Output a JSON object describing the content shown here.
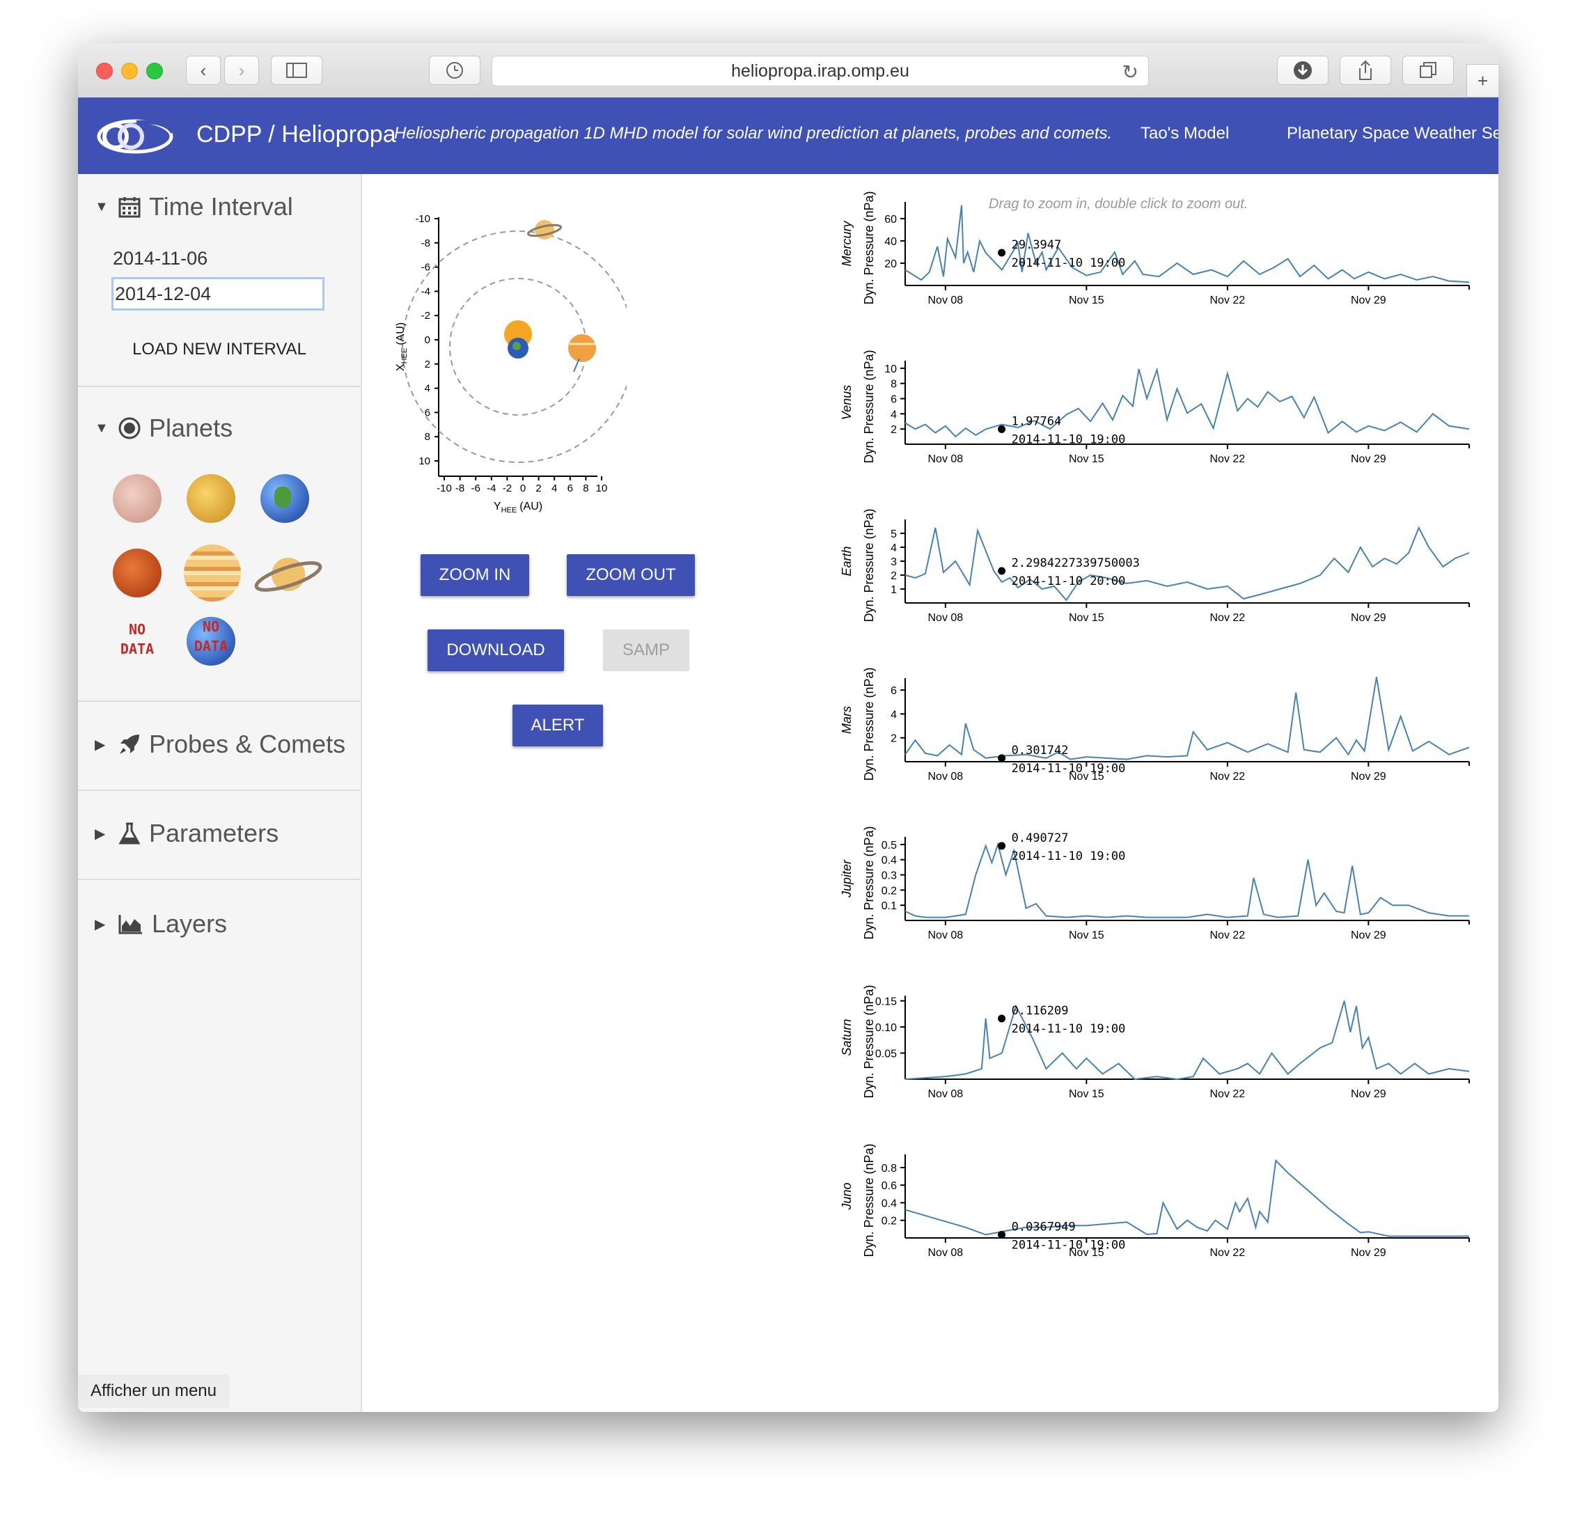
{
  "browser": {
    "url": "heliopropa.irap.omp.eu"
  },
  "header": {
    "brand": "CDPP / Heliopropa",
    "tagline": "Heliospheric propagation 1D MHD model for solar wind prediction at planets, probes and comets.",
    "nav": [
      "Tao's Model",
      "Planetary Space Weather Se"
    ]
  },
  "sidebar": {
    "time_interval": {
      "title": "Time Interval",
      "start": "2014-11-06",
      "end": "2014-12-04",
      "load_button": "LOAD NEW INTERVAL"
    },
    "planets": {
      "title": "Planets",
      "nodata_label_1": "NO",
      "nodata_label_2": "DATA",
      "items": [
        "mercury",
        "venus",
        "earth",
        "mars",
        "jupiter",
        "saturn",
        "rosetta",
        "juno"
      ]
    },
    "probes": {
      "title": "Probes & Comets"
    },
    "parameters": {
      "title": "Parameters"
    },
    "layers": {
      "title": "Layers"
    },
    "footer_hint": "Afficher un menu"
  },
  "orbit_plot": {
    "x_axis_label": "Y",
    "x_axis_sub": "HEE",
    "x_axis_unit": "(AU)",
    "y_axis_label": "X",
    "y_axis_sub": "HEE",
    "y_axis_unit": "(AU)",
    "ticks": [
      "-10",
      "-8",
      "-6",
      "-4",
      "-2",
      "0",
      "2",
      "4",
      "6",
      "8",
      "10"
    ]
  },
  "controls": {
    "zoom_in": "ZOOM IN",
    "zoom_out": "ZOOM OUT",
    "download": "DOWNLOAD",
    "samp": "SAMP",
    "alert": "ALERT"
  },
  "hint": "Drag to zoom in, double click to zoom out.",
  "chart_data": [
    {
      "type": "line",
      "title": "",
      "planet": "Mercury",
      "ylabel": "Dyn. Pressure (nPa)",
      "ylim": [
        0,
        75
      ],
      "yticks": [
        "20",
        "40",
        "60"
      ],
      "ytick_values": [
        20,
        40,
        60
      ],
      "xticks": [
        "Nov 08",
        "Nov 15",
        "Nov 22",
        "Nov 29"
      ],
      "xtick_days": [
        8,
        15,
        22,
        29
      ],
      "xlim_days": [
        6,
        34
      ],
      "x_days": [
        6.0,
        6.8,
        7.2,
        7.6,
        7.9,
        8.1,
        8.5,
        8.8,
        8.9,
        9.1,
        9.4,
        9.7,
        10.0,
        10.8,
        11.6,
        11.8,
        12.1,
        12.5,
        12.8,
        13.0,
        13.6,
        14.3,
        15.0,
        15.7,
        16.4,
        16.8,
        17.4,
        17.8,
        18.6,
        19.5,
        20.3,
        21.2,
        22.0,
        22.8,
        23.6,
        24.3,
        25.0,
        25.6,
        26.3,
        27.0,
        27.7,
        28.3,
        29.0,
        29.8,
        30.6,
        31.4,
        32.2,
        33.0,
        34.0
      ],
      "values": [
        14,
        5,
        12,
        35,
        8,
        42,
        25,
        72,
        20,
        30,
        12,
        40,
        29.3947,
        14,
        38,
        12,
        47,
        20,
        30,
        14,
        34,
        16,
        9,
        12,
        30,
        10,
        22,
        10,
        8,
        20,
        10,
        14,
        8,
        22,
        10,
        16,
        24,
        8,
        18,
        6,
        14,
        6,
        12,
        6,
        10,
        5,
        8,
        4,
        3
      ],
      "cursor": {
        "value": "29.3947",
        "time": "2014-11-10 19:00"
      }
    },
    {
      "type": "line",
      "title": "",
      "planet": "Venus",
      "ylabel": "Dyn. Pressure (nPa)",
      "ylim": [
        0,
        11
      ],
      "yticks": [
        "2",
        "4",
        "6",
        "8",
        "10"
      ],
      "ytick_values": [
        2,
        4,
        6,
        8,
        10
      ],
      "xticks": [
        "Nov 08",
        "Nov 15",
        "Nov 22",
        "Nov 29"
      ],
      "xtick_days": [
        8,
        15,
        22,
        29
      ],
      "xlim_days": [
        6,
        34
      ],
      "x_days": [
        6.0,
        6.5,
        7.0,
        7.5,
        8.0,
        8.5,
        9.0,
        9.5,
        10.0,
        10.8,
        11.6,
        12.4,
        13.2,
        14.0,
        14.6,
        15.2,
        15.8,
        16.3,
        16.8,
        17.3,
        17.6,
        18.0,
        18.5,
        19.0,
        19.5,
        20.0,
        20.7,
        21.3,
        22.0,
        22.5,
        23.0,
        23.5,
        24.0,
        24.6,
        25.2,
        25.8,
        26.3,
        27.0,
        27.7,
        28.4,
        29.0,
        29.8,
        30.6,
        31.4,
        32.2,
        33.0,
        34.0
      ],
      "values": [
        2.8,
        2.0,
        2.6,
        1.5,
        2.4,
        1.0,
        2.1,
        1.2,
        1.97764,
        2.6,
        2.2,
        3.1,
        2.0,
        3.9,
        4.7,
        3.0,
        5.4,
        3.2,
        6.4,
        5.0,
        9.9,
        6.0,
        9.8,
        3.2,
        7.3,
        4.1,
        5.3,
        2.1,
        9.3,
        4.4,
        6.0,
        4.9,
        6.9,
        5.6,
        6.3,
        3.5,
        6.2,
        1.5,
        3.0,
        1.6,
        2.4,
        1.8,
        2.9,
        1.6,
        4.0,
        2.4,
        2.0
      ],
      "cursor": {
        "value": "1.97764",
        "time": "2014-11-10 19:00"
      }
    },
    {
      "type": "line",
      "title": "",
      "planet": "Earth",
      "ylabel": "Dyn. Pressure (nPa)",
      "ylim": [
        0,
        6
      ],
      "yticks": [
        "1",
        "2",
        "3",
        "4",
        "5"
      ],
      "ytick_values": [
        1,
        2,
        3,
        4,
        5
      ],
      "xticks": [
        "Nov 08",
        "Nov 15",
        "Nov 22",
        "Nov 29"
      ],
      "xtick_days": [
        8,
        15,
        22,
        29
      ],
      "xlim_days": [
        6,
        34
      ],
      "x_days": [
        6.0,
        6.5,
        7.0,
        7.5,
        7.9,
        8.5,
        9.2,
        9.6,
        10.4,
        10.8,
        11.2,
        11.6,
        12.2,
        12.8,
        13.4,
        14.0,
        14.6,
        15.2,
        16.0,
        17.0,
        18.0,
        19.0,
        20.0,
        21.0,
        22.0,
        22.8,
        23.6,
        24.6,
        25.6,
        26.6,
        27.3,
        28.0,
        28.6,
        29.2,
        29.8,
        30.4,
        31.0,
        31.5,
        32.0,
        32.7,
        33.3,
        34.0
      ],
      "values": [
        2.0,
        1.8,
        2.1,
        5.4,
        2.2,
        3.0,
        1.3,
        5.2,
        2.2984227339750003,
        1.5,
        1.8,
        1.1,
        1.7,
        1.0,
        1.2,
        0.2,
        1.5,
        2.0,
        1.8,
        1.4,
        1.6,
        1.2,
        1.5,
        1.0,
        1.2,
        0.3,
        0.6,
        1.0,
        1.4,
        2.0,
        3.2,
        2.2,
        4.0,
        2.6,
        3.2,
        2.8,
        3.6,
        5.4,
        4.0,
        2.6,
        3.2,
        3.6
      ],
      "cursor": {
        "value": "2.2984227339750003",
        "time": "2014-11-10 20:00"
      }
    },
    {
      "type": "line",
      "title": "",
      "planet": "Mars",
      "ylabel": "Dyn. Pressure (nPa)",
      "ylim": [
        0,
        7
      ],
      "yticks": [
        "2",
        "4",
        "6"
      ],
      "ytick_values": [
        2,
        4,
        6
      ],
      "xticks": [
        "Nov 08",
        "Nov 15",
        "Nov 22",
        "Nov 29"
      ],
      "xtick_days": [
        8,
        15,
        22,
        29
      ],
      "xlim_days": [
        6,
        34
      ],
      "x_days": [
        6.0,
        6.5,
        7.0,
        7.6,
        8.2,
        8.8,
        9.0,
        9.4,
        10.0,
        11.0,
        12.0,
        13.0,
        13.6,
        14.2,
        15.0,
        16.0,
        17.0,
        18.0,
        19.0,
        20.0,
        20.3,
        21.0,
        22.0,
        23.0,
        24.0,
        25.0,
        25.4,
        25.8,
        26.6,
        27.4,
        28.0,
        28.4,
        28.8,
        29.4,
        30.0,
        30.6,
        31.2,
        32.0,
        33.0,
        34.0
      ],
      "values": [
        0.6,
        1.8,
        0.7,
        0.5,
        1.4,
        0.6,
        3.2,
        1.0,
        0.301742,
        0.5,
        0.6,
        0.3,
        0.8,
        0.2,
        0.4,
        0.3,
        0.2,
        0.5,
        0.4,
        0.5,
        2.5,
        1.0,
        1.6,
        0.8,
        1.5,
        0.8,
        5.8,
        1.0,
        0.8,
        2.0,
        0.6,
        1.8,
        0.9,
        7.1,
        1.0,
        3.8,
        0.9,
        1.7,
        0.6,
        1.2
      ],
      "cursor": {
        "value": "0.301742",
        "time": "2014-11-10 19:00"
      }
    },
    {
      "type": "line",
      "title": "",
      "planet": "Jupiter",
      "ylabel": "Dyn. Pressure (nPa)",
      "ylim": [
        0,
        0.55
      ],
      "yticks": [
        "0.1",
        "0.2",
        "0.3",
        "0.4",
        "0.5"
      ],
      "ytick_values": [
        0.1,
        0.2,
        0.3,
        0.4,
        0.5
      ],
      "xticks": [
        "Nov 08",
        "Nov 15",
        "Nov 22",
        "Nov 29"
      ],
      "xtick_days": [
        8,
        15,
        22,
        29
      ],
      "xlim_days": [
        6,
        34
      ],
      "x_days": [
        6.0,
        6.5,
        7.0,
        8.0,
        9.0,
        9.5,
        10.0,
        10.3,
        10.6,
        11.0,
        11.4,
        12.0,
        12.5,
        13.0,
        14.0,
        15.0,
        16.0,
        17.0,
        18.0,
        19.0,
        20.0,
        21.0,
        22.0,
        23.0,
        23.3,
        23.8,
        24.5,
        25.5,
        26.0,
        26.4,
        26.8,
        27.4,
        27.8,
        28.2,
        28.6,
        29.0,
        29.6,
        30.2,
        31.0,
        32.0,
        33.0,
        34.0
      ],
      "values": [
        0.06,
        0.03,
        0.02,
        0.02,
        0.04,
        0.3,
        0.490727,
        0.38,
        0.5,
        0.3,
        0.46,
        0.08,
        0.11,
        0.03,
        0.02,
        0.03,
        0.02,
        0.03,
        0.02,
        0.02,
        0.02,
        0.04,
        0.02,
        0.03,
        0.28,
        0.04,
        0.02,
        0.03,
        0.4,
        0.1,
        0.18,
        0.06,
        0.05,
        0.36,
        0.04,
        0.05,
        0.15,
        0.1,
        0.1,
        0.05,
        0.03,
        0.03
      ],
      "cursor": {
        "value": "0.490727",
        "time": "2014-11-10 19:00"
      }
    },
    {
      "type": "line",
      "title": "",
      "planet": "Saturn",
      "ylabel": "Dyn. Pressure (nPa)",
      "ylim": [
        0,
        0.16
      ],
      "yticks": [
        "0.05",
        "0.10",
        "0.15"
      ],
      "ytick_values": [
        0.05,
        0.1,
        0.15
      ],
      "xticks": [
        "Nov 08",
        "Nov 15",
        "Nov 22",
        "Nov 29"
      ],
      "xtick_days": [
        8,
        15,
        22,
        29
      ],
      "xlim_days": [
        6,
        34
      ],
      "x_days": [
        6.0,
        8.0,
        9.0,
        9.8,
        10.0,
        10.2,
        10.8,
        11.5,
        12.3,
        13.0,
        13.8,
        14.5,
        15.0,
        15.8,
        16.6,
        17.4,
        18.5,
        19.5,
        20.3,
        20.8,
        21.6,
        22.5,
        23.0,
        23.6,
        24.2,
        25.0,
        25.6,
        26.6,
        27.2,
        27.8,
        28.1,
        28.4,
        28.7,
        29.0,
        29.4,
        30.0,
        30.6,
        31.3,
        32.0,
        33.0,
        34.0
      ],
      "values": [
        0.0,
        0.005,
        0.01,
        0.02,
        0.116209,
        0.04,
        0.05,
        0.14,
        0.08,
        0.02,
        0.05,
        0.02,
        0.04,
        0.01,
        0.03,
        0.0,
        0.005,
        0.0,
        0.005,
        0.04,
        0.01,
        0.02,
        0.03,
        0.01,
        0.05,
        0.01,
        0.03,
        0.06,
        0.07,
        0.15,
        0.09,
        0.14,
        0.06,
        0.08,
        0.02,
        0.03,
        0.01,
        0.03,
        0.01,
        0.02,
        0.015
      ],
      "cursor": {
        "value": "0.116209",
        "time": "2014-11-10 19:00"
      }
    },
    {
      "type": "line",
      "title": "",
      "planet": "Juno",
      "ylabel": "Dyn. Pressure (nPa)",
      "ylim": [
        0,
        0.95
      ],
      "yticks": [
        "0.2",
        "0.4",
        "0.6",
        "0.8"
      ],
      "ytick_values": [
        0.2,
        0.4,
        0.6,
        0.8
      ],
      "xticks": [
        "Nov 08",
        "Nov 15",
        "Nov 22",
        "Nov 29"
      ],
      "xtick_days": [
        8,
        15,
        22,
        29
      ],
      "xlim_days": [
        6,
        34
      ],
      "x_days": [
        6.0,
        9.0,
        10.0,
        11.0,
        12.0,
        13.0,
        14.0,
        15.0,
        16.0,
        17.0,
        18.0,
        18.5,
        18.8,
        19.5,
        20.0,
        20.5,
        21.0,
        21.4,
        22.0,
        22.4,
        22.6,
        23.0,
        23.4,
        23.6,
        24.0,
        24.4,
        25.0,
        26.0,
        27.0,
        28.0,
        28.6,
        29.0,
        30.0,
        31.0,
        32.0,
        33.0,
        34.0
      ],
      "values": [
        0.32,
        0.12,
        0.0367949,
        0.08,
        0.12,
        0.12,
        0.14,
        0.14,
        0.16,
        0.18,
        0.04,
        0.05,
        0.4,
        0.1,
        0.2,
        0.12,
        0.08,
        0.2,
        0.1,
        0.4,
        0.3,
        0.45,
        0.12,
        0.3,
        0.18,
        0.88,
        0.74,
        0.54,
        0.34,
        0.16,
        0.06,
        0.07,
        0.02,
        0.02,
        0.02,
        0.02,
        0.02
      ],
      "cursor": {
        "value": "0.0367949",
        "time": "2014-11-10 19:00"
      }
    }
  ]
}
